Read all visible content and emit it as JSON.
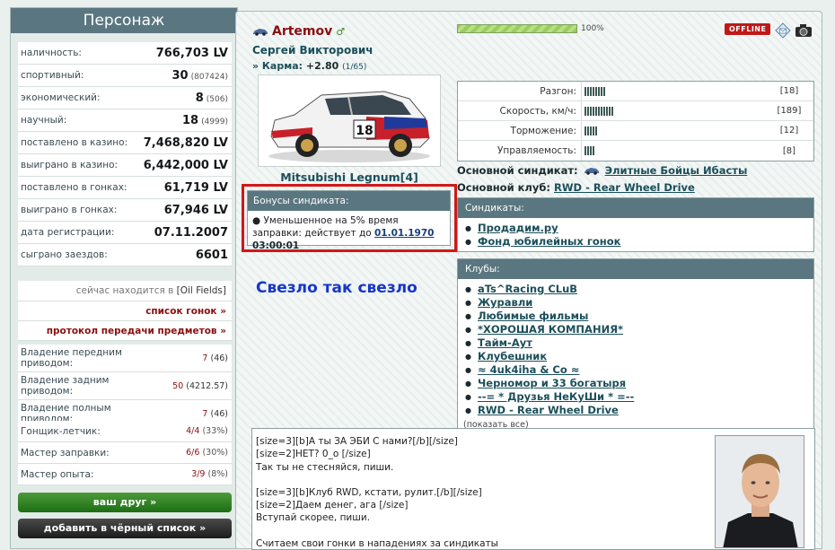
{
  "sidebar": {
    "title": "Персонаж",
    "stats": [
      {
        "label": "наличность:",
        "value": "766,703 LV",
        "sub": ""
      },
      {
        "label": "спортивный:",
        "value": "30",
        "sub": "(807424)"
      },
      {
        "label": "экономический:",
        "value": "8",
        "sub": "(506)"
      },
      {
        "label": "научный:",
        "value": "18",
        "sub": "(4999)"
      },
      {
        "label": "поставлено в казино:",
        "value": "7,468,820 LV",
        "sub": ""
      },
      {
        "label": "выиграно в казино:",
        "value": "6,442,000 LV",
        "sub": ""
      },
      {
        "label": "поставлено в гонках:",
        "value": "61,719 LV",
        "sub": ""
      },
      {
        "label": "выиграно в гонках:",
        "value": "67,946 LV",
        "sub": ""
      },
      {
        "label": "дата регистрации:",
        "value": "07.11.2007",
        "sub": ""
      },
      {
        "label": "сыграно заездов:",
        "value": "6601",
        "sub": ""
      }
    ],
    "location_prefix": "сейчас находится в",
    "location": "[Oil Fields]",
    "race_list_link": "список гонок »",
    "transfer_link": "протокол передачи предметов »",
    "drives": [
      {
        "label": "Владение передним приводом:",
        "num": "7",
        "sub": "(46)"
      },
      {
        "label": "Владение задним приводом:",
        "num": "50",
        "sub": "(4212.57)"
      },
      {
        "label": "Владение полным приводом:",
        "num": "7",
        "sub": "(46)"
      }
    ],
    "skills": [
      {
        "label": "Гонщик-летчик:",
        "num": "4/4",
        "sub": "(33%)"
      },
      {
        "label": "Мастер заправки:",
        "num": "6/6",
        "sub": "(30%)"
      },
      {
        "label": "Мастер опыта:",
        "num": "3/9",
        "sub": "(8%)"
      }
    ],
    "friend_button": "ваш друг »",
    "blacklist_button": "добавить в чёрный список »"
  },
  "profile": {
    "username": "Artemov",
    "gender_symbol": "♂",
    "full_name": "Сергей Викторович",
    "karma_label": "» Карма:",
    "karma_value": "+2.80",
    "karma_sub": "(1/65)",
    "progress_percent": 100,
    "progress_text": "100%",
    "status": "OFFLINE",
    "car_name": "Mitsubishi Legnum[4]",
    "car_number": "18",
    "slogan": "Свезло так свезло"
  },
  "bonus": {
    "title": "Бонусы синдиката:",
    "text": "Уменьшенное на 5% время заправки: действует до",
    "date": "01.01.1970",
    "time": "03:00:01"
  },
  "specs": [
    {
      "label": "Разгон:",
      "bars": 8,
      "value": "[18]"
    },
    {
      "label": "Скорость, км/ч:",
      "bars": 11,
      "value": "[189]"
    },
    {
      "label": "Торможение:",
      "bars": 5,
      "value": "[12]"
    },
    {
      "label": "Управляемость:",
      "bars": 4,
      "value": "[8]"
    }
  ],
  "main_syndicate_label": "Основной синдикат:",
  "main_syndicate": "Элитные Бойцы Ибасты",
  "main_club_label": "Основной клуб:",
  "main_club": "RWD - Rear Wheel Drive",
  "syndicates": {
    "title": "Синдикаты:",
    "items": [
      "Продадим.ру",
      "Фонд юбилейных гонок"
    ]
  },
  "clubs": {
    "title": "Клубы:",
    "items": [
      "aTs^Racing CLuB",
      "Журавли",
      "Любимые фильмы",
      "*ХОРОШАЯ КОМПАНИЯ*",
      "Тайм-Аут",
      "Клубешник",
      "≈ 4uk4iha & Co ≈",
      "Черномор и 33 богатыря",
      "--= * Друзья НеКуШи * =--",
      "RWD - Rear Wheel Drive"
    ],
    "show_all": "(показать все)"
  },
  "about": {
    "lines": [
      "[size=3][b]А ты ЗА ЭБИ С нами?[/b][/size]",
      "[size=2]НЕТ? 0_о [/size]",
      "Так ты не стесняйся, пиши.",
      "",
      "[size=3][b]Клуб RWD, кстати, рулит.[/b][/size]",
      "[size=2]Даем денег, ага [/size]",
      "Вступай скорее, пиши.",
      "",
      "Считаем свои гонки в нападениях за синдикаты"
    ]
  },
  "colors": {
    "header_bg": "#5a7680",
    "accent_red": "#8a0f0f",
    "link": "#1b4f5a",
    "slogan": "#1636c8",
    "highlight_border": "#d11818"
  }
}
